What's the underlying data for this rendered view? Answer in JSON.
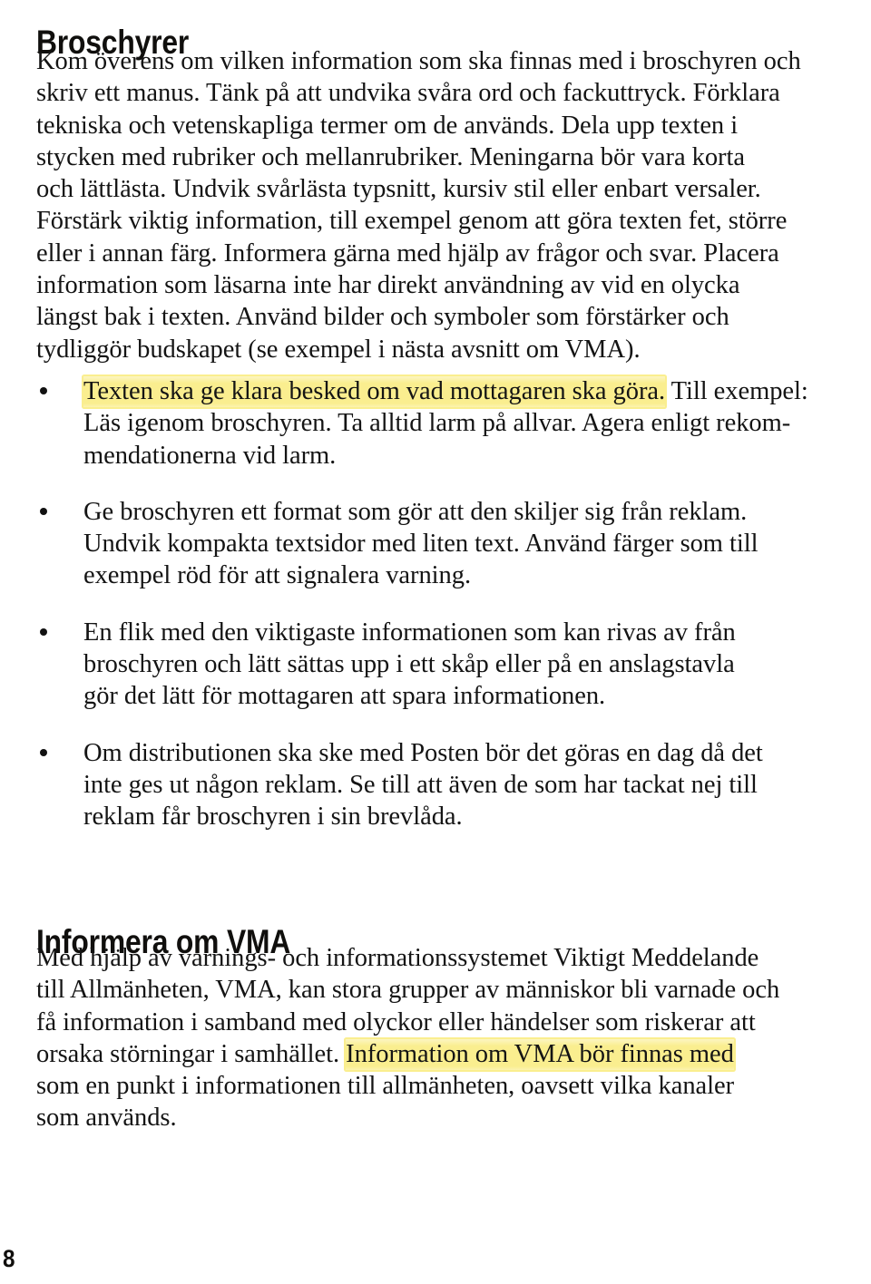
{
  "document": {
    "page_number": "8",
    "highlight_color": "#faee8f",
    "text_color": "#141414"
  },
  "sections": {
    "broschyrer": {
      "heading": "Broschyrer",
      "paragraph_lines": [
        "Kom överens om vilken information som ska finnas med i broschyren och",
        "skriv ett manus. Tänk på att undvika svåra ord och fackuttryck. Förklara",
        "tekniska och vetenskapliga termer om de används. Dela upp texten i",
        "stycken med rubriker och mellanrubriker. Meningarna bör vara korta",
        "och lättlästa. Undvik svårlästa typsnitt, kursiv stil eller enbart versaler.",
        "Förstärk viktig information, till exempel genom att göra texten fet, större",
        "eller i annan färg. Informera gärna med hjälp av frågor och svar. Placera",
        "information som läsarna inte har direkt användning av vid en olycka",
        "längst bak i texten. Använd bilder och symboler som förstärker och",
        "tydliggör budskapet (se exempel i nästa avsnitt om VMA)."
      ],
      "bullets": [
        {
          "highlighted_text": "Texten ska ge klara besked om vad mottagaren ska göra.",
          "rest_first_line": " Till exempel:",
          "lines": [
            "Läs igenom broschyren. Ta alltid larm på allvar. Agera enligt rekom-",
            "mendationerna vid larm."
          ]
        },
        {
          "highlighted_text": "",
          "rest_first_line": "Ge broschyren ett format som gör att den skiljer sig från reklam.",
          "lines": [
            "Undvik kompakta textsidor med liten text. Använd färger som till",
            "exempel röd för att signalera varning."
          ]
        },
        {
          "highlighted_text": "",
          "rest_first_line": "En flik med den viktigaste informationen som kan rivas av från",
          "lines": [
            "broschyren och lätt sättas upp i ett skåp eller på en anslagstavla",
            "gör det lätt för mottagaren att spara informationen."
          ]
        },
        {
          "highlighted_text": "",
          "rest_first_line": "Om distributionen ska ske med Posten bör det göras en dag då det",
          "lines": [
            "inte ges ut någon reklam. Se till att även de som har tackat nej till",
            "reklam får broschyren i sin brevlåda."
          ]
        }
      ]
    },
    "informera_om_vma": {
      "heading": "Informera om VMA",
      "paragraph_lines": [
        "Med hjälp av varnings- och informationssystemet Viktigt Meddelande",
        "till Allmänheten, VMA, kan stora grupper av människor bli varnade och",
        "få information i samband med olyckor eller händelser som riskerar att"
      ],
      "line_with_highlight": {
        "before": "orsaka störningar i samhället. ",
        "highlighted": "Information om VMA bör finnas med",
        "after": ""
      },
      "paragraph_lines_after": [
        "som en punkt i informationen till allmänheten, oavsett vilka kanaler",
        "som används."
      ]
    }
  }
}
